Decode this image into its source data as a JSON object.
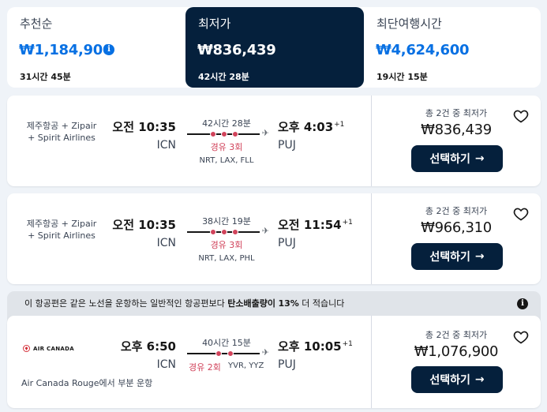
{
  "sort_tabs": [
    {
      "label": "추천순",
      "price": "₩1,184,900",
      "duration": "31시간 45분",
      "active": false
    },
    {
      "label": "최저가",
      "price": "₩836,439",
      "duration": "42시간 28분",
      "active": true
    },
    {
      "label": "최단여행시간",
      "price": "₩4,624,600",
      "duration": "19시간 15분",
      "active": false
    }
  ],
  "results": [
    {
      "airline": "제주항공 + Zipair + Spirit Airlines",
      "airline_line1": "제주항공 + Zipair",
      "airline_line2": "+ Spirit Airlines",
      "dep_time": "오전 10:35",
      "dep_code": "ICN",
      "duration": "42시간 28분",
      "stops_label": "경유 3회",
      "via": "NRT, LAX, FLL",
      "arr_time": "오후 4:03",
      "arr_day_offset": "+1",
      "arr_code": "PUJ",
      "deal_note": "총 2건 중 최저가",
      "price": "₩836,439",
      "select_label": "선택하기",
      "stop_count": 3
    },
    {
      "airline": "제주항공 + Zipair + Spirit Airlines",
      "airline_line1": "제주항공 + Zipair",
      "airline_line2": "+ Spirit Airlines",
      "dep_time": "오전 10:35",
      "dep_code": "ICN",
      "duration": "38시간 19분",
      "stops_label": "경유 3회",
      "via": "NRT, LAX, PHL",
      "arr_time": "오전 11:54",
      "arr_day_offset": "+1",
      "arr_code": "PUJ",
      "deal_note": "총 2건 중 최저가",
      "price": "₩966,310",
      "select_label": "선택하기",
      "stop_count": 3
    },
    {
      "airline": "AIR CANADA",
      "dep_time": "오후 6:50",
      "dep_code": "ICN",
      "duration": "40시간 15분",
      "stops_label": "경유 2회",
      "via": "YVR, YYZ",
      "arr_time": "오후 10:05",
      "arr_day_offset": "+1",
      "arr_code": "PUJ",
      "deal_note": "총 2건 중 최저가",
      "price": "₩1,076,900",
      "select_label": "선택하기",
      "operated_by": "Air Canada Rouge에서 부분 운항",
      "stop_count": 2
    }
  ],
  "eco_banner": {
    "text_before": "이 항공편은 같은 노선을 운항하는 일반적인 항공편보다 ",
    "highlight": "탄소배출량이",
    "percent": "13%",
    "text_after": " 더 적습니다"
  },
  "icons": {
    "info": "info-icon",
    "heart": "heart-icon",
    "plane": "plane-icon",
    "arrow": "arrow-right-icon"
  },
  "colors": {
    "accent": "#0770e3",
    "dark": "#05203c",
    "stop": "#d1435b"
  }
}
